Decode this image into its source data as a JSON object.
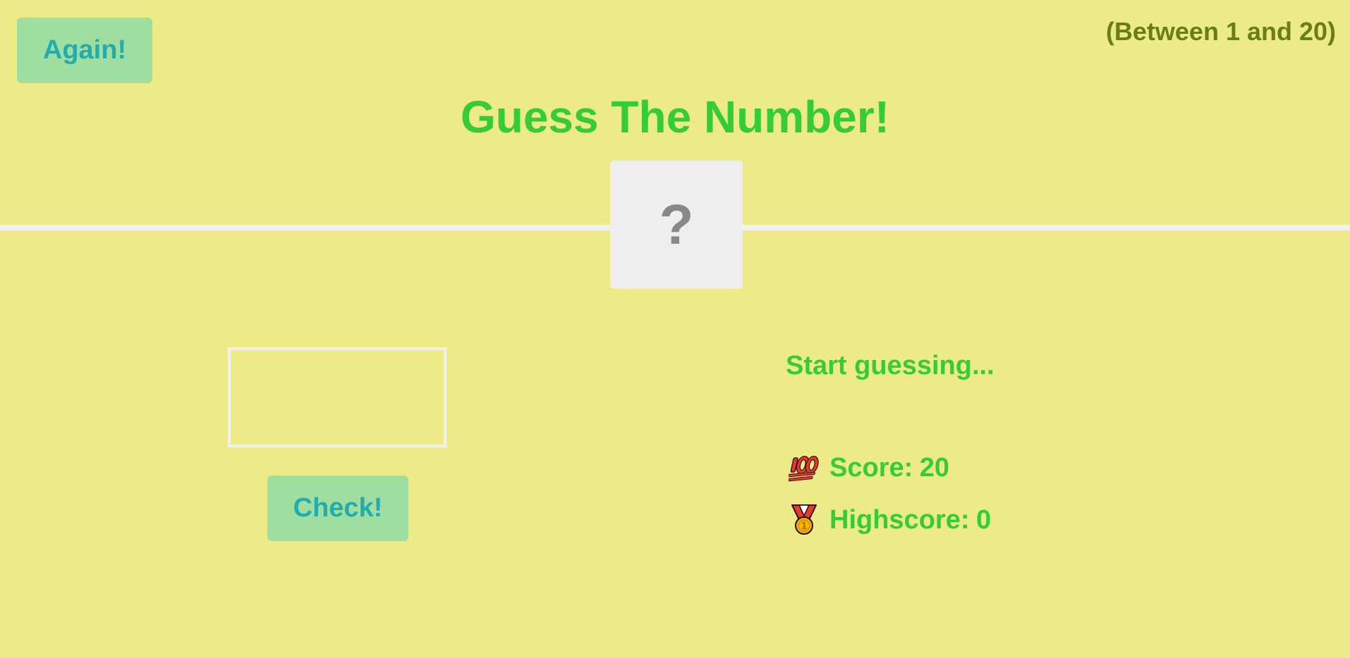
{
  "header": {
    "again_label": "Again!",
    "range_text": "(Between 1 and 20)",
    "title": "Guess The Number!"
  },
  "secret": {
    "display": "?"
  },
  "guess": {
    "value": ""
  },
  "check_label": "Check!",
  "status": {
    "message": "Start guessing...",
    "score_icon": "hundred-points-icon",
    "score_label": "Score:",
    "score_value": "20",
    "highscore_icon": "medal-icon",
    "highscore_label": "Highscore:",
    "highscore_value": "0"
  },
  "colors": {
    "background": "#ECEB87",
    "primary_text": "#35CC35",
    "button_bg": "#A0DE9F",
    "button_text": "#22ACB0",
    "range_text": "#6A7D16",
    "number_box_bg": "#EEEEEE",
    "number_box_text": "#888888"
  }
}
